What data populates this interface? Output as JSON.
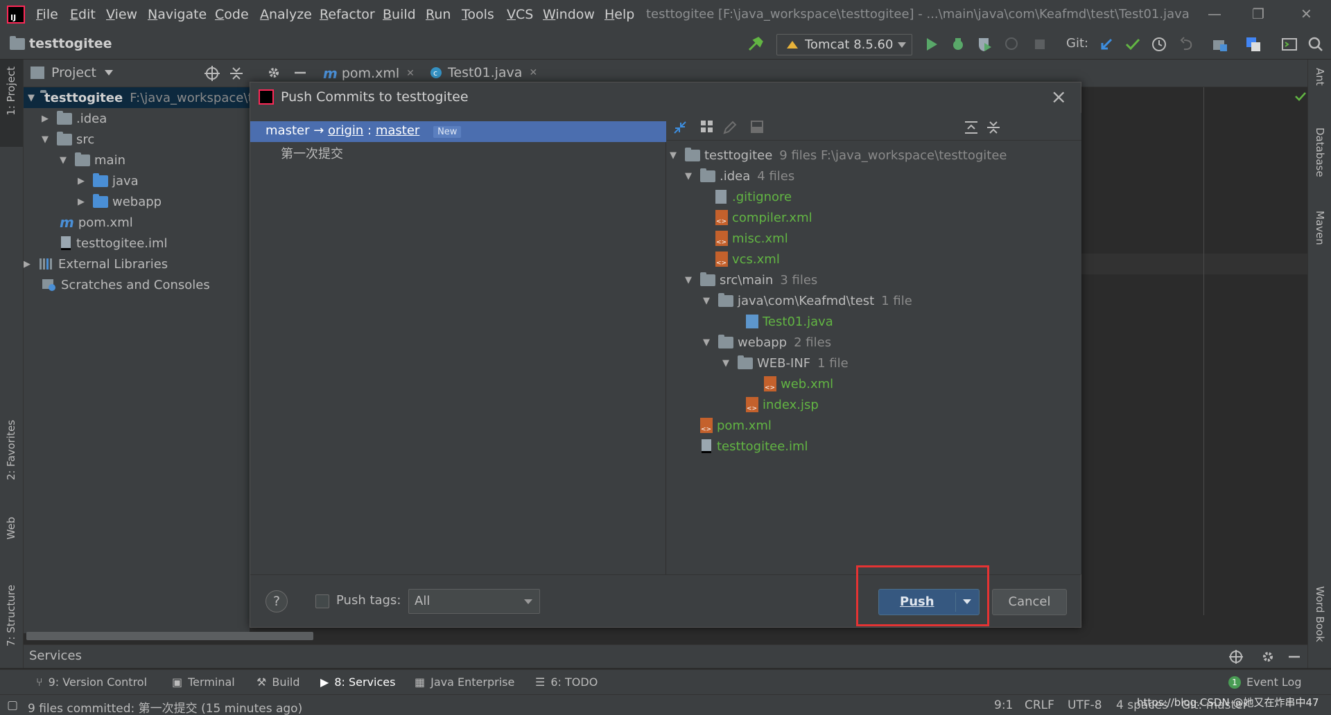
{
  "menubar": {
    "items": [
      "File",
      "Edit",
      "View",
      "Navigate",
      "Code",
      "Analyze",
      "Refactor",
      "Build",
      "Run",
      "Tools",
      "VCS",
      "Window",
      "Help"
    ],
    "window_title": "testtogitee [F:\\java_workspace\\testtogitee] - ...\\main\\java\\com\\Keafmd\\test\\Test01.java"
  },
  "navbar": {
    "project": "testtogitee",
    "run_config": "Tomcat 8.5.60",
    "git_label": "Git:"
  },
  "left_strip": {
    "project_tab": "1: Project",
    "favorites_tab": "2: Favorites",
    "web_tab": "Web",
    "structure_tab": "7: Structure"
  },
  "right_strip": {
    "ant_tab": "Ant",
    "database_tab": "Database",
    "maven_tab": "Maven",
    "wordbook_tab": "Word Book"
  },
  "project_panel": {
    "title": "Project",
    "tree": [
      {
        "label": "testtogitee",
        "hint": "F:\\java_workspace\\t"
      },
      {
        "label": ".idea"
      },
      {
        "label": "src"
      },
      {
        "label": "main"
      },
      {
        "label": "java"
      },
      {
        "label": "webapp"
      },
      {
        "label": "pom.xml"
      },
      {
        "label": "testtogitee.iml"
      },
      {
        "label": "External Libraries"
      },
      {
        "label": "Scratches and Consoles"
      }
    ]
  },
  "editor_tabs": [
    {
      "label": "pom.xml"
    },
    {
      "label": "Test01.java"
    }
  ],
  "dialog": {
    "title": "Push Commits to testtogitee",
    "branch": {
      "local": "master",
      "arrow": "→",
      "remote": "origin",
      "sep": ":",
      "target": "master",
      "badge": "New"
    },
    "commit_message": "第一次提交",
    "files": [
      {
        "name": "testtogitee",
        "hint": "9 files  F:\\java_workspace\\testtogitee"
      },
      {
        "name": ".idea",
        "hint": "4 files"
      },
      {
        "name": ".gitignore"
      },
      {
        "name": "compiler.xml"
      },
      {
        "name": "misc.xml"
      },
      {
        "name": "vcs.xml"
      },
      {
        "name": "src\\main",
        "hint": "3 files"
      },
      {
        "name": "java\\com\\Keafmd\\test",
        "hint": "1 file"
      },
      {
        "name": "Test01.java"
      },
      {
        "name": "webapp",
        "hint": "2 files"
      },
      {
        "name": "WEB-INF",
        "hint": "1 file"
      },
      {
        "name": "web.xml"
      },
      {
        "name": "index.jsp"
      },
      {
        "name": "pom.xml"
      },
      {
        "name": "testtogitee.iml"
      }
    ],
    "footer": {
      "help": "?",
      "push_tags_label": "Push tags:",
      "tags_select_value": "All",
      "push_button": "Push",
      "cancel_button": "Cancel"
    }
  },
  "services": {
    "label": "Services"
  },
  "toolwindows": [
    {
      "label": "9: Version Control"
    },
    {
      "label": "Terminal"
    },
    {
      "label": "Build"
    },
    {
      "label": "8: Services"
    },
    {
      "label": "Java Enterprise"
    },
    {
      "label": "6: TODO"
    }
  ],
  "event_log": {
    "count": "1",
    "label": "Event Log"
  },
  "statusbar": {
    "message": "9 files committed: 第一次提交 (15 minutes ago)",
    "position": "9:1",
    "line_sep": "CRLF",
    "encoding": "UTF-8",
    "indent": "4 spaces",
    "git": "Git: master",
    "watermark": "https://blog.CSDN @她又在炸串中47"
  },
  "colors": {
    "accent": "#4b6eaf",
    "push_button": "#365880",
    "highlight_box": "#e53333",
    "file_added": "#62b543"
  }
}
